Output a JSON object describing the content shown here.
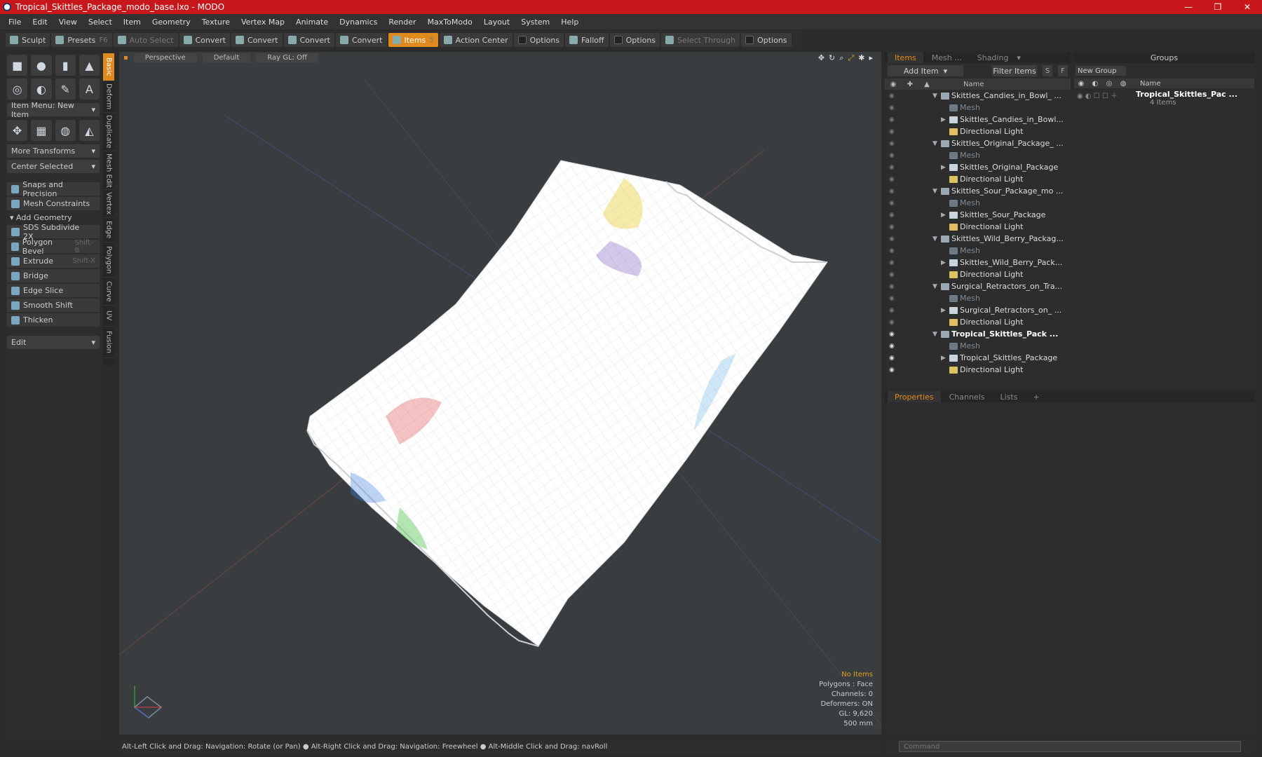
{
  "window": {
    "title": "Tropical_Skittles_Package_modo_base.lxo - MODO",
    "minimize": "—",
    "maximize": "❐",
    "close": "✕"
  },
  "menu": [
    "File",
    "Edit",
    "View",
    "Select",
    "Item",
    "Geometry",
    "Texture",
    "Vertex Map",
    "Animate",
    "Dynamics",
    "Render",
    "MaxToModo",
    "Layout",
    "System",
    "Help"
  ],
  "toolbar": {
    "sculpt": "Sculpt",
    "presets": "Presets",
    "presets_shortcut": "F6",
    "auto_select": "Auto Select",
    "convert1": "Convert",
    "convert2": "Convert",
    "convert3": "Convert",
    "convert4": "Convert",
    "items": "Items",
    "items_shortcut": "5",
    "action_center": "Action Center",
    "options1": "Options",
    "falloff": "Falloff",
    "options2": "Options",
    "select_through": "Select Through",
    "options3": "Options"
  },
  "left": {
    "item_menu": "Item Menu: New Item",
    "more_transforms": "More Transforms",
    "center_selected": "Center Selected",
    "snaps": "Snaps and Precision",
    "mesh_constraints": "Mesh Constraints",
    "add_geometry": "Add Geometry",
    "tools": [
      {
        "label": "SDS Subdivide 2X",
        "shortcut": ""
      },
      {
        "label": "Polygon Bevel",
        "shortcut": "Shift-B"
      },
      {
        "label": "Extrude",
        "shortcut": "Shift-X"
      },
      {
        "label": "Bridge",
        "shortcut": ""
      },
      {
        "label": "Edge Slice",
        "shortcut": ""
      },
      {
        "label": "Smooth Shift",
        "shortcut": ""
      },
      {
        "label": "Thicken",
        "shortcut": ""
      }
    ],
    "edit": "Edit"
  },
  "vtabs": [
    "Basic",
    "Deform",
    "Duplicate",
    "Mesh Edit",
    "Vertex",
    "Edge",
    "Polygon",
    "Curve",
    "UV",
    "Fusion"
  ],
  "viewport": {
    "view": "Perspective",
    "shading": "Default",
    "raygl": "Ray GL: Off",
    "info": {
      "selection": "No Items",
      "polygons": "Polygons : Face",
      "channels": "Channels: 0",
      "deformers": "Deformers: ON",
      "gl": "GL: 9,620",
      "scale": "500 mm"
    }
  },
  "status": "Alt-Left Click and Drag: Navigation: Rotate (or Pan) ● Alt-Right Click and Drag: Navigation: Freewheel ● Alt-Middle Click and Drag: navRoll",
  "items_panel": {
    "tabs": [
      "Items",
      "Mesh ...",
      "Shading"
    ],
    "add_item": "Add Item",
    "filter_items": "Filter Items",
    "s": "S",
    "f": "F",
    "name_col": "Name",
    "rows": [
      {
        "label": "Skittles_Candies_in_Bowl_ ...",
        "kind": "scene",
        "bold": false
      },
      {
        "label": "Mesh",
        "kind": "mesh",
        "bold": false
      },
      {
        "label": "Skittles_Candies_in_Bowl...",
        "kind": "item",
        "bold": false
      },
      {
        "label": "Directional Light",
        "kind": "light",
        "bold": false
      },
      {
        "label": "Skittles_Original_Package_ ...",
        "kind": "scene",
        "bold": false
      },
      {
        "label": "Mesh",
        "kind": "mesh",
        "bold": false
      },
      {
        "label": "Skittles_Original_Package",
        "kind": "item",
        "bold": false
      },
      {
        "label": "Directional Light",
        "kind": "light",
        "bold": false
      },
      {
        "label": "Skittles_Sour_Package_mo ...",
        "kind": "scene",
        "bold": false
      },
      {
        "label": "Mesh",
        "kind": "mesh",
        "bold": false
      },
      {
        "label": "Skittles_Sour_Package",
        "kind": "item",
        "bold": false
      },
      {
        "label": "Directional Light",
        "kind": "light",
        "bold": false
      },
      {
        "label": "Skittles_Wild_Berry_Packag...",
        "kind": "scene",
        "bold": false
      },
      {
        "label": "Mesh",
        "kind": "mesh",
        "bold": false
      },
      {
        "label": "Skittles_Wild_Berry_Pack...",
        "kind": "item",
        "bold": false
      },
      {
        "label": "Directional Light",
        "kind": "light",
        "bold": false
      },
      {
        "label": "Surgical_Retractors_on_Tra...",
        "kind": "scene",
        "bold": false
      },
      {
        "label": "Mesh",
        "kind": "mesh",
        "bold": false
      },
      {
        "label": "Surgical_Retractors_on_ ...",
        "kind": "item",
        "bold": false
      },
      {
        "label": "Directional Light",
        "kind": "light",
        "bold": false
      },
      {
        "label": "Tropical_Skittles_Pack ...",
        "kind": "scene",
        "bold": true
      },
      {
        "label": "Mesh",
        "kind": "mesh",
        "bold": false
      },
      {
        "label": "Tropical_Skittles_Package",
        "kind": "item",
        "bold": false
      },
      {
        "label": "Directional Light",
        "kind": "light",
        "bold": false
      }
    ]
  },
  "groups_panel": {
    "title": "Groups",
    "new_group": "New Group",
    "name_col": "Name",
    "group_name": "Tropical_Skittles_Pac ...",
    "group_count": "4 Items"
  },
  "props_panel": {
    "tabs": [
      "Properties",
      "Channels",
      "Lists",
      "+"
    ]
  },
  "command": {
    "placeholder": "Command"
  }
}
